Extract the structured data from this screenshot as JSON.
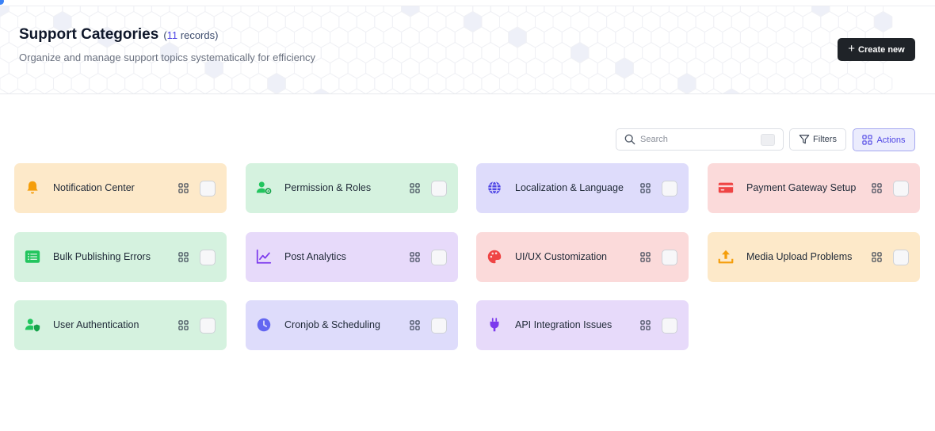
{
  "header": {
    "title": "Support Categories",
    "count_prefix": "(",
    "count_number": "11",
    "count_suffix": " records)",
    "subtitle": "Organize and manage support topics systematically for efficiency",
    "create_label": "Create new"
  },
  "toolbar": {
    "search_placeholder": "Search",
    "filters_label": "Filters",
    "actions_label": "Actions"
  },
  "colors": {
    "orange_bg": "#fde9c9",
    "green_bg": "#d5f2df",
    "blue_bg": "#dedcfb",
    "red_bg": "#fbdada",
    "purple_bg": "#e7dafa",
    "accent": "#4f46e5"
  },
  "categories": [
    {
      "label": "Notification Center",
      "icon": "bell-icon",
      "color": "orange"
    },
    {
      "label": "Permission & Roles",
      "icon": "user-gear-icon",
      "color": "green"
    },
    {
      "label": "Localization & Language",
      "icon": "globe-icon",
      "color": "blue"
    },
    {
      "label": "Payment Gateway Setup",
      "icon": "credit-card-icon",
      "color": "red"
    },
    {
      "label": "Bulk Publishing Errors",
      "icon": "list-icon",
      "color": "green"
    },
    {
      "label": "Post Analytics",
      "icon": "chart-line-icon",
      "color": "purple"
    },
    {
      "label": "UI/UX Customization",
      "icon": "palette-icon",
      "color": "red"
    },
    {
      "label": "Media Upload Problems",
      "icon": "upload-icon",
      "color": "orange"
    },
    {
      "label": "User Authentication",
      "icon": "user-shield-icon",
      "color": "green"
    },
    {
      "label": "Cronjob & Scheduling",
      "icon": "clock-icon",
      "color": "blue"
    },
    {
      "label": "API Integration Issues",
      "icon": "plug-icon",
      "color": "purple"
    }
  ]
}
